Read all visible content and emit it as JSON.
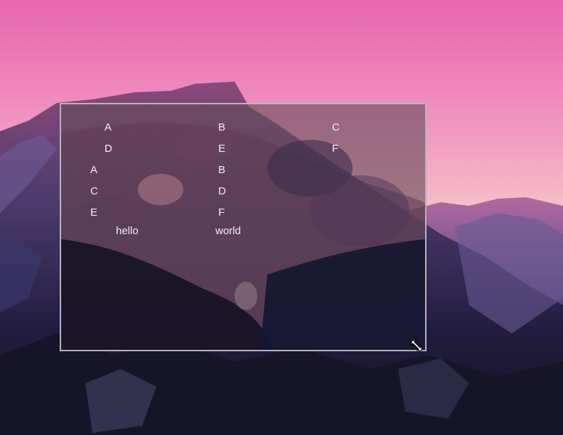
{
  "window": {
    "grid_labels": {
      "row1_col1": "A",
      "row1_col2": "B",
      "row1_col3": "C",
      "row2_col1": "D",
      "row2_col2": "E",
      "row2_col3": "F"
    },
    "stack_left": [
      "A",
      "C",
      "E"
    ],
    "stack_right": [
      "B",
      "D",
      "F"
    ],
    "caption_left": "hello",
    "caption_right": "world"
  },
  "cursor": {
    "icon": "resize-diagonal-icon"
  },
  "colors": {
    "sky_top": "#e96fb4",
    "sky_bottom": "#f9d7dc",
    "mountain_dark": "#1e1a3a",
    "mountain_light": "#7a5a8a",
    "window_border": "#b9b4bb",
    "label_text": "#f2eef4"
  }
}
